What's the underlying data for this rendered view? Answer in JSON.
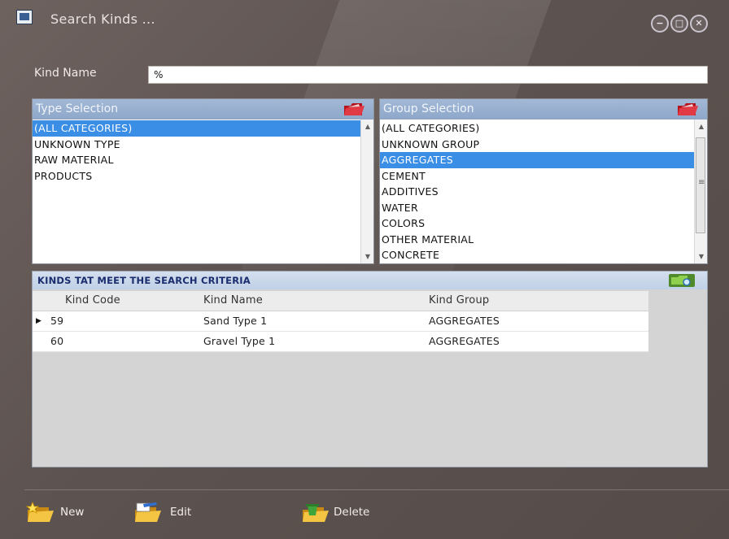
{
  "window": {
    "title": "Search Kinds ..."
  },
  "kind_name": {
    "label": "Kind Name",
    "value": "%"
  },
  "type_selection": {
    "header": "Type Selection",
    "items": [
      "(ALL CATEGORIES)",
      "UNKNOWN TYPE",
      "RAW MATERIAL",
      "PRODUCTS"
    ],
    "selected": "(ALL CATEGORIES)"
  },
  "group_selection": {
    "header": "Group Selection",
    "items": [
      "(ALL CATEGORIES)",
      "UNKNOWN GROUP",
      "AGGREGATES",
      "CEMENT",
      "ADDITIVES",
      "WATER",
      "COLORS",
      "OTHER MATERIAL",
      "CONCRETE"
    ],
    "selected": "AGGREGATES"
  },
  "results": {
    "title": "KINDS TAT MEET THE SEARCH CRITERIA",
    "columns": [
      "Kind Code",
      "Kind Name",
      "Kind Group"
    ],
    "rows": [
      {
        "code": "59",
        "name": "Sand Type 1",
        "group": "AGGREGATES"
      },
      {
        "code": "60",
        "name": "Gravel Type 1",
        "group": "AGGREGATES"
      }
    ]
  },
  "actions": {
    "new": "New",
    "edit": "Edit",
    "delete": "Delete"
  },
  "colors": {
    "selection": "#3a8ee6",
    "header_blue": "#9fb5d4",
    "grid_title_text": "#1a2d6e",
    "window_bg": "#5f5552"
  },
  "icons": {
    "title": "app-window-icon",
    "minimize": "minimize-icon",
    "maximize": "maximize-icon",
    "close": "close-icon",
    "type_header": "red-folder-icon",
    "group_header": "red-folder-icon",
    "grid": "green-search-folder-icon",
    "new": "new-folder-star-icon",
    "edit": "edit-folder-icon",
    "delete": "delete-folder-icon"
  }
}
